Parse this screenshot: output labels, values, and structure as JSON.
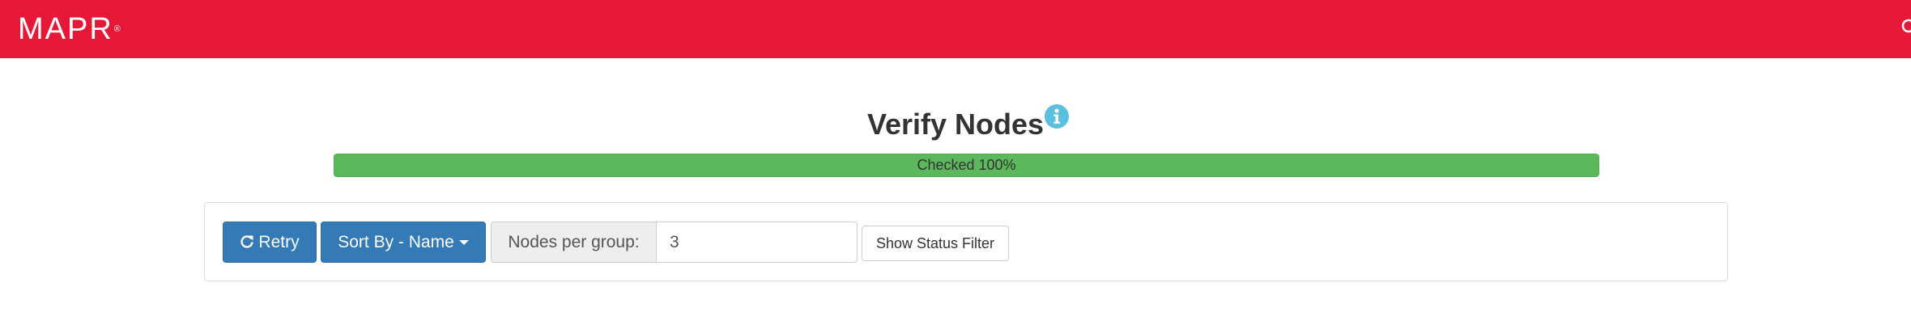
{
  "header": {
    "logo_text": "MAPR",
    "logo_mark": "®",
    "brand_color": "#e71837",
    "edge_icon": "search-icon"
  },
  "main": {
    "title": "Verify Nodes",
    "info_icon": "info-circle-icon",
    "progress": {
      "label": "Checked 100%",
      "value_fraction": 1.0,
      "color": "#5cb85c"
    }
  },
  "toolbar": {
    "retry_label": "Retry",
    "retry_icon": "refresh-icon",
    "sort_label": "Sort By - Name",
    "sort_icon": "caret-down-icon",
    "nodes_per_group_label": "Nodes per group:",
    "nodes_per_group_value": "3",
    "show_status_filter_label": "Show Status Filter",
    "primary_color": "#337ab7"
  }
}
